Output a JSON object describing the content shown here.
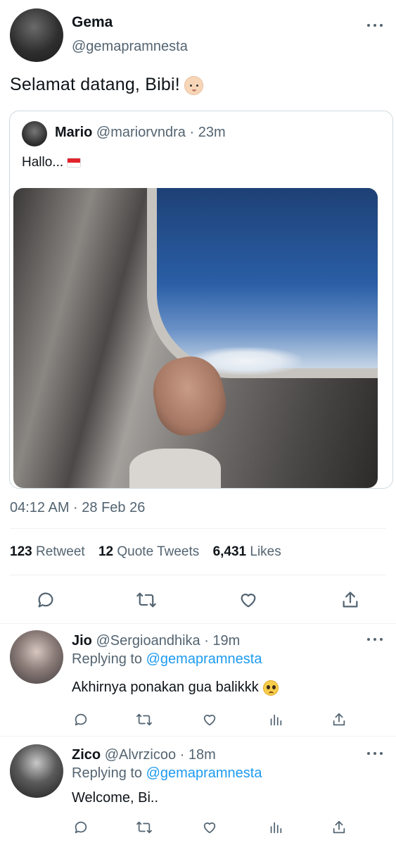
{
  "main_tweet": {
    "author_name": "Gema",
    "author_handle": "@gemapramnesta",
    "text": "Selamat datang, Bibi!",
    "text_emoji": "baby-face-emoji",
    "timestamp": "04:12 AM · 28 Feb 26",
    "stats": {
      "retweets_count": "123",
      "retweets_label": "Retweet",
      "quotes_count": "12",
      "quotes_label": "Quote Tweets",
      "likes_count": "6,431",
      "likes_label": "Likes"
    },
    "actions": [
      "reply-icon",
      "retweet-icon",
      "like-icon",
      "share-icon"
    ]
  },
  "quoted_tweet": {
    "author_name": "Mario",
    "author_handle": "@mariorvndra",
    "time": "· 23m",
    "text": "Hallo...",
    "text_emoji": "indonesia-flag-emoji"
  },
  "replies": [
    {
      "author_name": "Jio",
      "author_handle": "@Sergioandhika",
      "time": "· 19m",
      "replying_prefix": "Replying to",
      "replying_to": "@gemapramnesta",
      "text": "Akhirnya ponakan gua balikkk",
      "text_emoji": "pleading-face-emoji"
    },
    {
      "author_name": "Zico",
      "author_handle": "@Alvrzicoo",
      "time": "· 18m",
      "replying_prefix": "Replying to",
      "replying_to": "@gemapramnesta",
      "text": "Welcome, Bi.."
    }
  ],
  "colors": {
    "text": "#0f1419",
    "muted": "#536471",
    "link": "#1d9bf0",
    "border": "#cfd9de"
  }
}
